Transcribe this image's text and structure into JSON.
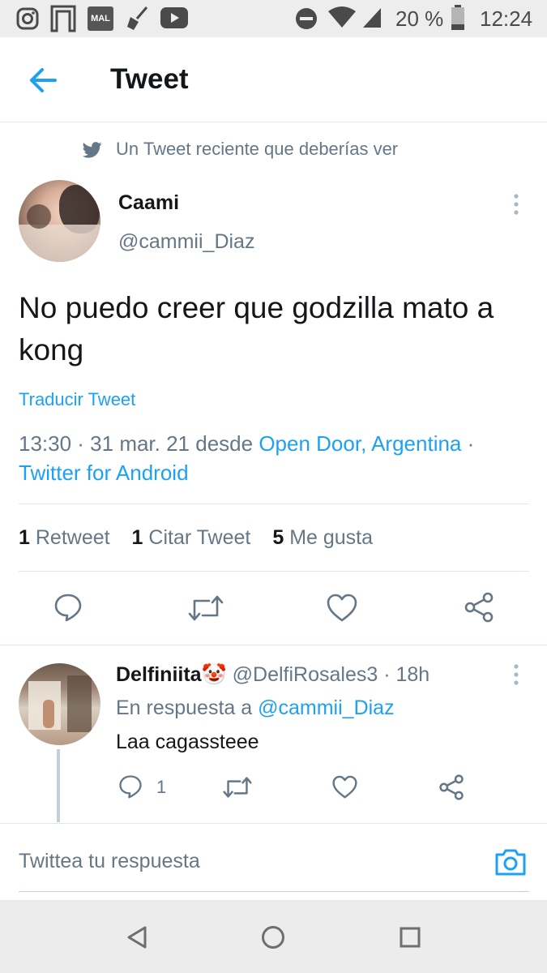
{
  "status_bar": {
    "battery": "20 %",
    "time": "12:24",
    "mal_label": "MAL"
  },
  "header": {
    "title": "Tweet"
  },
  "recommendation": "Un Tweet reciente que deberías ver",
  "tweet": {
    "author_name": "Caami",
    "author_handle": "@cammii_Diaz",
    "text": "No puedo creer que godzilla mato a kong",
    "translate": "Traducir Tweet",
    "timestamp": "13:30 · 31 mar. 21 desde",
    "location": "Open Door, Argentina",
    "separator": "·",
    "source": "Twitter for Android",
    "stats": {
      "retweets_count": "1",
      "retweets_label": "Retweet",
      "quotes_count": "1",
      "quotes_label": "Citar Tweet",
      "likes_count": "5",
      "likes_label": "Me gusta"
    }
  },
  "reply": {
    "name": "Delfiniita🤡",
    "handle_time": "@DelfiRosales3 · 18h",
    "in_reply_prefix": "En respuesta a",
    "in_reply_handle": "@cammii_Diaz",
    "text": "Laa cagassteee",
    "reply_count": "1"
  },
  "compose": {
    "placeholder": "Twittea tu respuesta"
  },
  "icons": {
    "accent": "#1da1f2",
    "secondary": "#657786",
    "names": [
      "back-arrow-icon",
      "twitter-bird-icon",
      "more-vertical-icon",
      "reply-icon",
      "retweet-icon",
      "like-icon",
      "share-icon",
      "camera-icon",
      "nav-back-icon",
      "nav-home-icon",
      "nav-recents-icon"
    ]
  }
}
